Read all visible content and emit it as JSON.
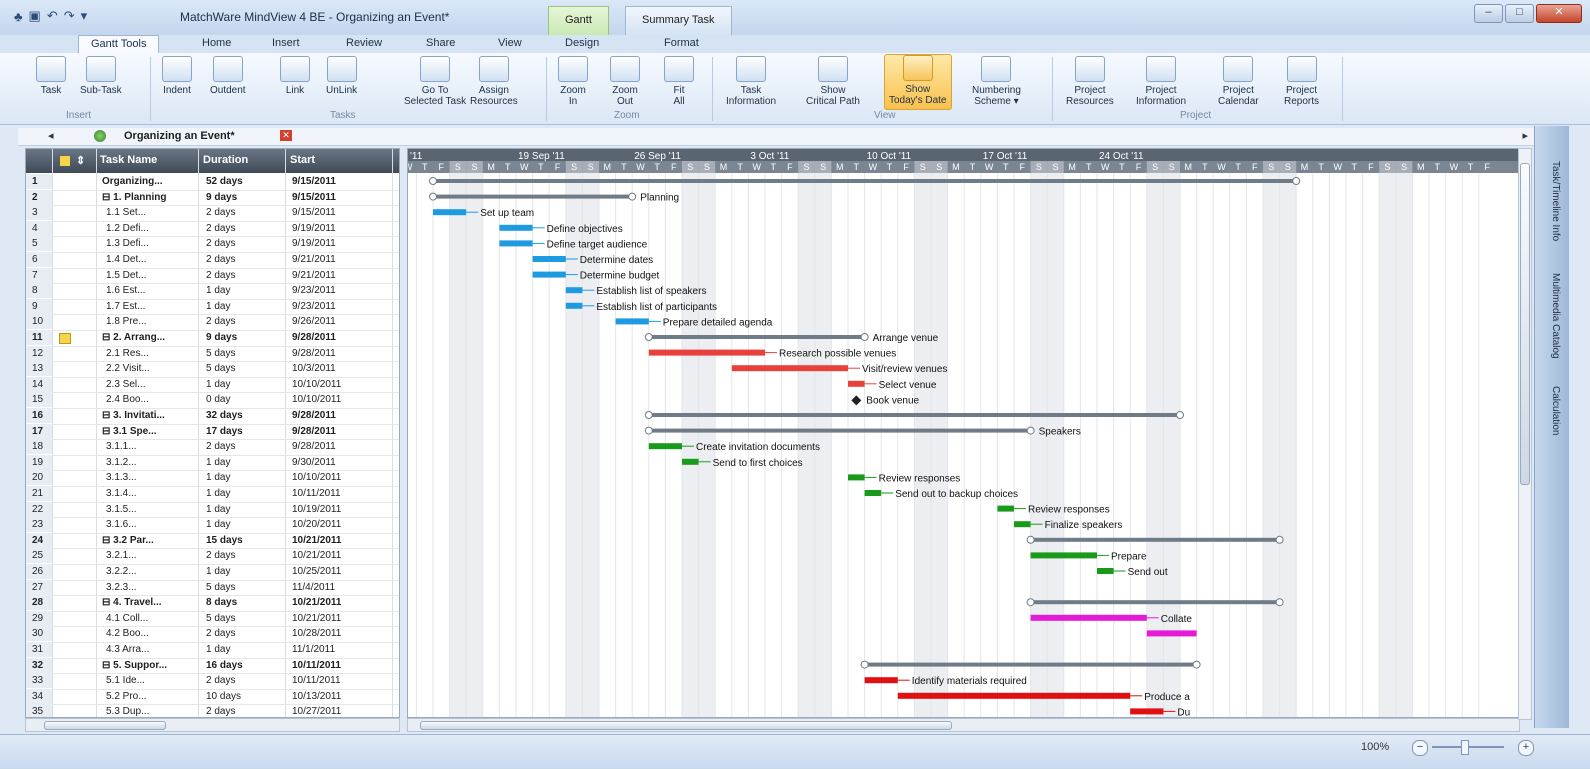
{
  "window": {
    "title": "MatchWare MindView 4 BE - Organizing an Event*",
    "context_tabs": [
      "Gantt",
      "Summary Task"
    ],
    "controls": {
      "minimize": "–",
      "maximize": "□",
      "close": "✕"
    }
  },
  "tabs": {
    "app_button": "▾",
    "items": [
      "Gantt Tools",
      "Home",
      "Insert",
      "Review",
      "Share",
      "View",
      "Design",
      "Format"
    ],
    "active": "Gantt Tools",
    "help": "?"
  },
  "ribbon": {
    "buttons": {
      "task": "Task",
      "sub_task": "Sub-Task",
      "indent": "Indent",
      "outdent": "Outdent",
      "link": "Link",
      "unlink": "UnLink",
      "goto": "Go To\nSelected Task",
      "assign": "Assign\nResources",
      "zoom_in": "Zoom\nIn",
      "zoom_out": "Zoom\nOut",
      "fit_all": "Fit\nAll",
      "task_info": "Task\nInformation",
      "critical": "Show\nCritical Path",
      "today": "Show\nToday's Date",
      "numbering": "Numbering\nScheme ▾",
      "proj_res": "Project\nResources",
      "proj_info": "Project\nInformation",
      "proj_cal": "Project\nCalendar",
      "proj_rep": "Project\nReports"
    },
    "groups": {
      "insert": "Insert",
      "tasks": "Tasks",
      "zoom": "Zoom",
      "view": "View",
      "project": "Project"
    }
  },
  "document": {
    "title": "Organizing an Event*",
    "nav_left": "◂",
    "nav_right": "▸",
    "close": "✕"
  },
  "grid": {
    "columns": {
      "name": "Task Name",
      "duration": "Duration",
      "start": "Start"
    },
    "rows": [
      {
        "n": "1",
        "name": "Organizing...",
        "dur": "52 days",
        "start": "9/15/2011",
        "sum": true
      },
      {
        "n": "2",
        "name": "⊟ 1. Planning",
        "dur": "9 days",
        "start": "9/15/2011",
        "sum": true
      },
      {
        "n": "3",
        "name": "1.1 Set...",
        "dur": "2 days",
        "start": "9/15/2011"
      },
      {
        "n": "4",
        "name": "1.2 Defi...",
        "dur": "2 days",
        "start": "9/19/2011"
      },
      {
        "n": "5",
        "name": "1.3 Defi...",
        "dur": "2 days",
        "start": "9/19/2011"
      },
      {
        "n": "6",
        "name": "1.4 Det...",
        "dur": "2 days",
        "start": "9/21/2011"
      },
      {
        "n": "7",
        "name": "1.5 Det...",
        "dur": "2 days",
        "start": "9/21/2011"
      },
      {
        "n": "8",
        "name": "1.6 Est...",
        "dur": "1 day",
        "start": "9/23/2011"
      },
      {
        "n": "9",
        "name": "1.7 Est...",
        "dur": "1 day",
        "start": "9/23/2011"
      },
      {
        "n": "10",
        "name": "1.8 Pre...",
        "dur": "2 days",
        "start": "9/26/2011"
      },
      {
        "n": "11",
        "name": "⊟ 2. Arrang...",
        "dur": "9 days",
        "start": "9/28/2011",
        "sum": true,
        "note": true
      },
      {
        "n": "12",
        "name": "2.1 Res...",
        "dur": "5 days",
        "start": "9/28/2011"
      },
      {
        "n": "13",
        "name": "2.2 Visit...",
        "dur": "5 days",
        "start": "10/3/2011"
      },
      {
        "n": "14",
        "name": "2.3 Sel...",
        "dur": "1 day",
        "start": "10/10/2011"
      },
      {
        "n": "15",
        "name": "2.4 Boo...",
        "dur": "0 day",
        "start": "10/10/2011"
      },
      {
        "n": "16",
        "name": "⊟ 3. Invitati...",
        "dur": "32 days",
        "start": "9/28/2011",
        "sum": true
      },
      {
        "n": "17",
        "name": "⊟ 3.1 Spe...",
        "dur": "17 days",
        "start": "9/28/2011",
        "sum": true
      },
      {
        "n": "18",
        "name": "3.1.1...",
        "dur": "2 days",
        "start": "9/28/2011"
      },
      {
        "n": "19",
        "name": "3.1.2...",
        "dur": "1 day",
        "start": "9/30/2011"
      },
      {
        "n": "20",
        "name": "3.1.3...",
        "dur": "1 day",
        "start": "10/10/2011"
      },
      {
        "n": "21",
        "name": "3.1.4...",
        "dur": "1 day",
        "start": "10/11/2011"
      },
      {
        "n": "22",
        "name": "3.1.5...",
        "dur": "1 day",
        "start": "10/19/2011"
      },
      {
        "n": "23",
        "name": "3.1.6...",
        "dur": "1 day",
        "start": "10/20/2011"
      },
      {
        "n": "24",
        "name": "⊟ 3.2 Par...",
        "dur": "15 days",
        "start": "10/21/2011",
        "sum": true
      },
      {
        "n": "25",
        "name": "3.2.1...",
        "dur": "2 days",
        "start": "10/21/2011"
      },
      {
        "n": "26",
        "name": "3.2.2...",
        "dur": "1 day",
        "start": "10/25/2011"
      },
      {
        "n": "27",
        "name": "3.2.3...",
        "dur": "5 days",
        "start": "11/4/2011"
      },
      {
        "n": "28",
        "name": "⊟ 4. Travel...",
        "dur": "8 days",
        "start": "10/21/2011",
        "sum": true
      },
      {
        "n": "29",
        "name": "4.1 Coll...",
        "dur": "5 days",
        "start": "10/21/2011"
      },
      {
        "n": "30",
        "name": "4.2 Boo...",
        "dur": "2 days",
        "start": "10/28/2011"
      },
      {
        "n": "31",
        "name": "4.3 Arra...",
        "dur": "1 day",
        "start": "11/1/2011"
      },
      {
        "n": "32",
        "name": "⊟ 5. Suppor...",
        "dur": "16 days",
        "start": "10/11/2011",
        "sum": true
      },
      {
        "n": "33",
        "name": "5.1 Ide...",
        "dur": "2 days",
        "start": "10/11/2011"
      },
      {
        "n": "34",
        "name": "5.2 Pro...",
        "dur": "10 days",
        "start": "10/13/2011"
      },
      {
        "n": "35",
        "name": "5.3 Dup...",
        "dur": "2 days",
        "start": "10/27/2011"
      }
    ]
  },
  "gantt": {
    "weeks": [
      "'11",
      "19 Sep '11",
      "26 Sep '11",
      "3 Oct '11",
      "10 Oct '11",
      "17 Oct '11",
      "24 Oct '11"
    ],
    "day_letters": [
      "M",
      "T",
      "W",
      "T",
      "F",
      "S",
      "S"
    ],
    "first_day_letters": [
      "W",
      "T",
      "F",
      "S",
      "S"
    ],
    "colors": {
      "planning": "#1e9be0",
      "venue": "#e8413c",
      "invitation": "#1a9a1a",
      "travel": "#e51ad6",
      "support": "#e10f0f",
      "summary": "#6f7b87"
    },
    "bars": [
      {
        "row": 0,
        "start": 0,
        "dur": 52,
        "kind": "summary"
      },
      {
        "row": 1,
        "start": 0,
        "dur": 12,
        "kind": "summary",
        "label": "Planning"
      },
      {
        "row": 2,
        "start": 0,
        "dur": 2,
        "kind": "planning",
        "label": "Set up team"
      },
      {
        "row": 3,
        "start": 4,
        "dur": 2,
        "kind": "planning",
        "label": "Define objectives"
      },
      {
        "row": 4,
        "start": 4,
        "dur": 2,
        "kind": "planning",
        "label": "Define target audience"
      },
      {
        "row": 5,
        "start": 6,
        "dur": 2,
        "kind": "planning",
        "label": "Determine dates"
      },
      {
        "row": 6,
        "start": 6,
        "dur": 2,
        "kind": "planning",
        "label": "Determine budget"
      },
      {
        "row": 7,
        "start": 8,
        "dur": 1,
        "kind": "planning",
        "label": "Establish list of speakers"
      },
      {
        "row": 8,
        "start": 8,
        "dur": 1,
        "kind": "planning",
        "label": "Establish list of participants"
      },
      {
        "row": 9,
        "start": 11,
        "dur": 2,
        "kind": "planning",
        "label": "Prepare detailed agenda"
      },
      {
        "row": 10,
        "start": 13,
        "dur": 13,
        "kind": "summary",
        "label": "Arrange venue"
      },
      {
        "row": 11,
        "start": 13,
        "dur": 7,
        "kind": "venue",
        "label": "Research possible venues"
      },
      {
        "row": 12,
        "start": 18,
        "dur": 7,
        "kind": "venue",
        "label": "Visit/review venues"
      },
      {
        "row": 13,
        "start": 25,
        "dur": 1,
        "kind": "venue",
        "label": "Select venue"
      },
      {
        "row": 14,
        "start": 25.5,
        "dur": 0,
        "kind": "milestone",
        "label": "Book venue"
      },
      {
        "row": 15,
        "start": 13,
        "dur": 32,
        "kind": "summary"
      },
      {
        "row": 16,
        "start": 13,
        "dur": 23,
        "kind": "summary",
        "label": "Speakers"
      },
      {
        "row": 17,
        "start": 13,
        "dur": 2,
        "kind": "invitation",
        "label": "Create invitation documents"
      },
      {
        "row": 18,
        "start": 15,
        "dur": 1,
        "kind": "invitation",
        "label": "Send to first choices"
      },
      {
        "row": 19,
        "start": 25,
        "dur": 1,
        "kind": "invitation",
        "label": "Review responses"
      },
      {
        "row": 20,
        "start": 26,
        "dur": 1,
        "kind": "invitation",
        "label": "Send out to backup choices"
      },
      {
        "row": 21,
        "start": 34,
        "dur": 1,
        "kind": "invitation",
        "label": "Review responses"
      },
      {
        "row": 22,
        "start": 35,
        "dur": 1,
        "kind": "invitation",
        "label": "Finalize speakers"
      },
      {
        "row": 23,
        "start": 36,
        "dur": 15,
        "kind": "summary"
      },
      {
        "row": 24,
        "start": 36,
        "dur": 4,
        "kind": "invitation",
        "label": "Prepare"
      },
      {
        "row": 25,
        "start": 40,
        "dur": 1,
        "kind": "invitation",
        "label": "Send out"
      },
      {
        "row": 27,
        "start": 36,
        "dur": 15,
        "kind": "summary"
      },
      {
        "row": 28,
        "start": 36,
        "dur": 7,
        "kind": "travel",
        "label": "Collate"
      },
      {
        "row": 29,
        "start": 43,
        "dur": 3,
        "kind": "travel"
      },
      {
        "row": 31,
        "start": 26,
        "dur": 20,
        "kind": "summary"
      },
      {
        "row": 32,
        "start": 26,
        "dur": 2,
        "kind": "support",
        "label": "Identify materials required"
      },
      {
        "row": 33,
        "start": 28,
        "dur": 14,
        "kind": "support",
        "label": "Produce a"
      },
      {
        "row": 34,
        "start": 42,
        "dur": 2,
        "kind": "support",
        "label": "Du"
      }
    ]
  },
  "side_tabs": [
    "Task/Timeline Info",
    "Multimedia Catalog",
    "Calculation"
  ],
  "status": {
    "zoom": "100%",
    "zoom_out": "−",
    "zoom_in": "+"
  }
}
